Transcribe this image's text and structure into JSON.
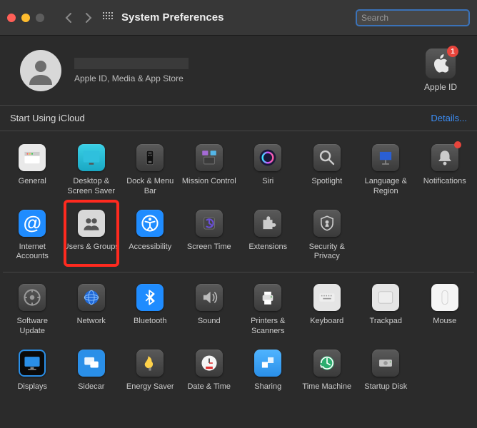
{
  "window": {
    "title": "System Preferences"
  },
  "search": {
    "placeholder": "Search"
  },
  "account": {
    "subtitle": "Apple ID, Media & App Store",
    "appleid_label": "Apple ID",
    "appleid_badge": "1"
  },
  "cloud": {
    "prompt": "Start Using iCloud",
    "details": "Details..."
  },
  "rows": [
    {
      "items": [
        {
          "id": "general",
          "label": "General"
        },
        {
          "id": "desktop",
          "label": "Desktop & Screen Saver"
        },
        {
          "id": "dock",
          "label": "Dock & Menu Bar"
        },
        {
          "id": "mission",
          "label": "Mission Control"
        },
        {
          "id": "siri",
          "label": "Siri"
        },
        {
          "id": "spotlight",
          "label": "Spotlight"
        },
        {
          "id": "language",
          "label": "Language & Region"
        },
        {
          "id": "notifications",
          "label": "Notifications",
          "reddot": true
        }
      ]
    },
    {
      "items": [
        {
          "id": "internet",
          "label": "Internet Accounts"
        },
        {
          "id": "users",
          "label": "Users & Groups",
          "highlight": true
        },
        {
          "id": "accessibility",
          "label": "Accessibility"
        },
        {
          "id": "screentime",
          "label": "Screen Time"
        },
        {
          "id": "extensions",
          "label": "Extensions"
        },
        {
          "id": "security",
          "label": "Security & Privacy"
        },
        {
          "id": "",
          "label": ""
        },
        {
          "id": "",
          "label": ""
        }
      ]
    },
    {
      "sep": true,
      "items": [
        {
          "id": "software",
          "label": "Software Update"
        },
        {
          "id": "network",
          "label": "Network"
        },
        {
          "id": "bluetooth",
          "label": "Bluetooth"
        },
        {
          "id": "sound",
          "label": "Sound"
        },
        {
          "id": "printers",
          "label": "Printers & Scanners"
        },
        {
          "id": "keyboard",
          "label": "Keyboard"
        },
        {
          "id": "trackpad",
          "label": "Trackpad"
        },
        {
          "id": "mouse",
          "label": "Mouse"
        }
      ]
    },
    {
      "items": [
        {
          "id": "displays",
          "label": "Displays"
        },
        {
          "id": "sidecar",
          "label": "Sidecar"
        },
        {
          "id": "energy",
          "label": "Energy Saver"
        },
        {
          "id": "datetime",
          "label": "Date & Time"
        },
        {
          "id": "sharing",
          "label": "Sharing"
        },
        {
          "id": "timemachine",
          "label": "Time Machine"
        },
        {
          "id": "startup",
          "label": "Startup Disk"
        },
        {
          "id": "",
          "label": ""
        }
      ]
    }
  ]
}
